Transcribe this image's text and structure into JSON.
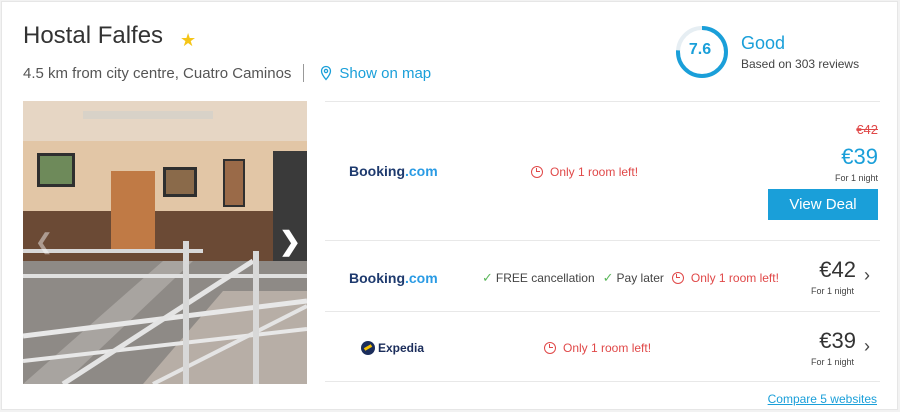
{
  "hotel": {
    "name": "Hostal Falfes",
    "distance": "4.5 km from city centre, Cuatro Caminos",
    "map_link": "Show on map"
  },
  "rating": {
    "score": "7.6",
    "label": "Good",
    "reviews": "Based on 303 reviews",
    "score_fraction": 0.76
  },
  "offers": [
    {
      "provider": "Booking",
      "provider_suffix": ".com",
      "notes": [
        "Only 1 room left!"
      ],
      "old_price": "€42",
      "price": "€39",
      "per_night": "For 1 night",
      "button": "View Deal"
    },
    {
      "provider": "Booking",
      "provider_suffix": ".com",
      "free_cancellation": "FREE cancellation",
      "pay_later": "Pay later",
      "notes": [
        "Only 1 room left!"
      ],
      "price": "€42",
      "per_night": "For 1 night"
    },
    {
      "provider": "Expedia",
      "notes": [
        "Only 1 room left!"
      ],
      "price": "€39",
      "per_night": "For 1 night"
    }
  ],
  "compare_link": "Compare 5 websites",
  "colors": {
    "accent": "#1a9fd9",
    "urgent": "#e04848",
    "ok": "#5cb85c",
    "star": "#f5c518"
  }
}
